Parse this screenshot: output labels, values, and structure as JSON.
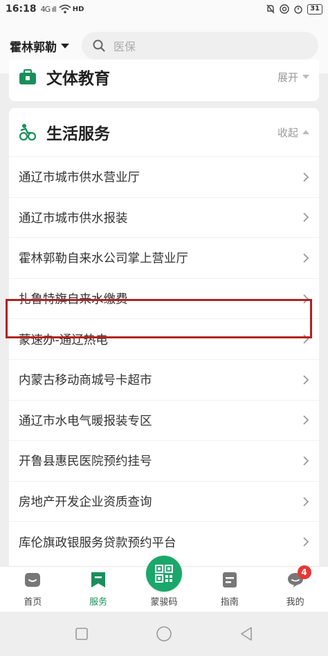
{
  "status_bar": {
    "time": "16:18",
    "signal": "4G ıll",
    "hd": "HD",
    "battery": "31"
  },
  "header": {
    "city": "霍林郭勒",
    "search_placeholder": "医保"
  },
  "sections": [
    {
      "title": "文体教育",
      "toggle": "展开",
      "expanded": false
    },
    {
      "title": "生活服务",
      "toggle": "收起",
      "expanded": true
    }
  ],
  "life_services": [
    "通辽市城市供水营业厅",
    "通辽市城市供水报装",
    "霍林郭勒自来水公司掌上营业厅",
    "扎鲁特旗自来水缴费",
    "蒙速办-通辽热电",
    "内蒙古移动商城号卡超市",
    "通辽市水电气暖报装专区",
    "开鲁县惠民医院预约挂号",
    "房地产开发企业资质查询",
    "库伦旗政银服务贷款预约平台"
  ],
  "tabs": [
    {
      "label": "首页",
      "active": false
    },
    {
      "label": "服务",
      "active": true
    },
    {
      "label": "蒙骏码",
      "active": false
    },
    {
      "label": "指南",
      "active": false
    },
    {
      "label": "我的",
      "active": false,
      "badge": "4"
    }
  ],
  "colors": {
    "accent": "#1a8f5c",
    "highlight_border": "#b22222",
    "badge": "#e53935"
  }
}
